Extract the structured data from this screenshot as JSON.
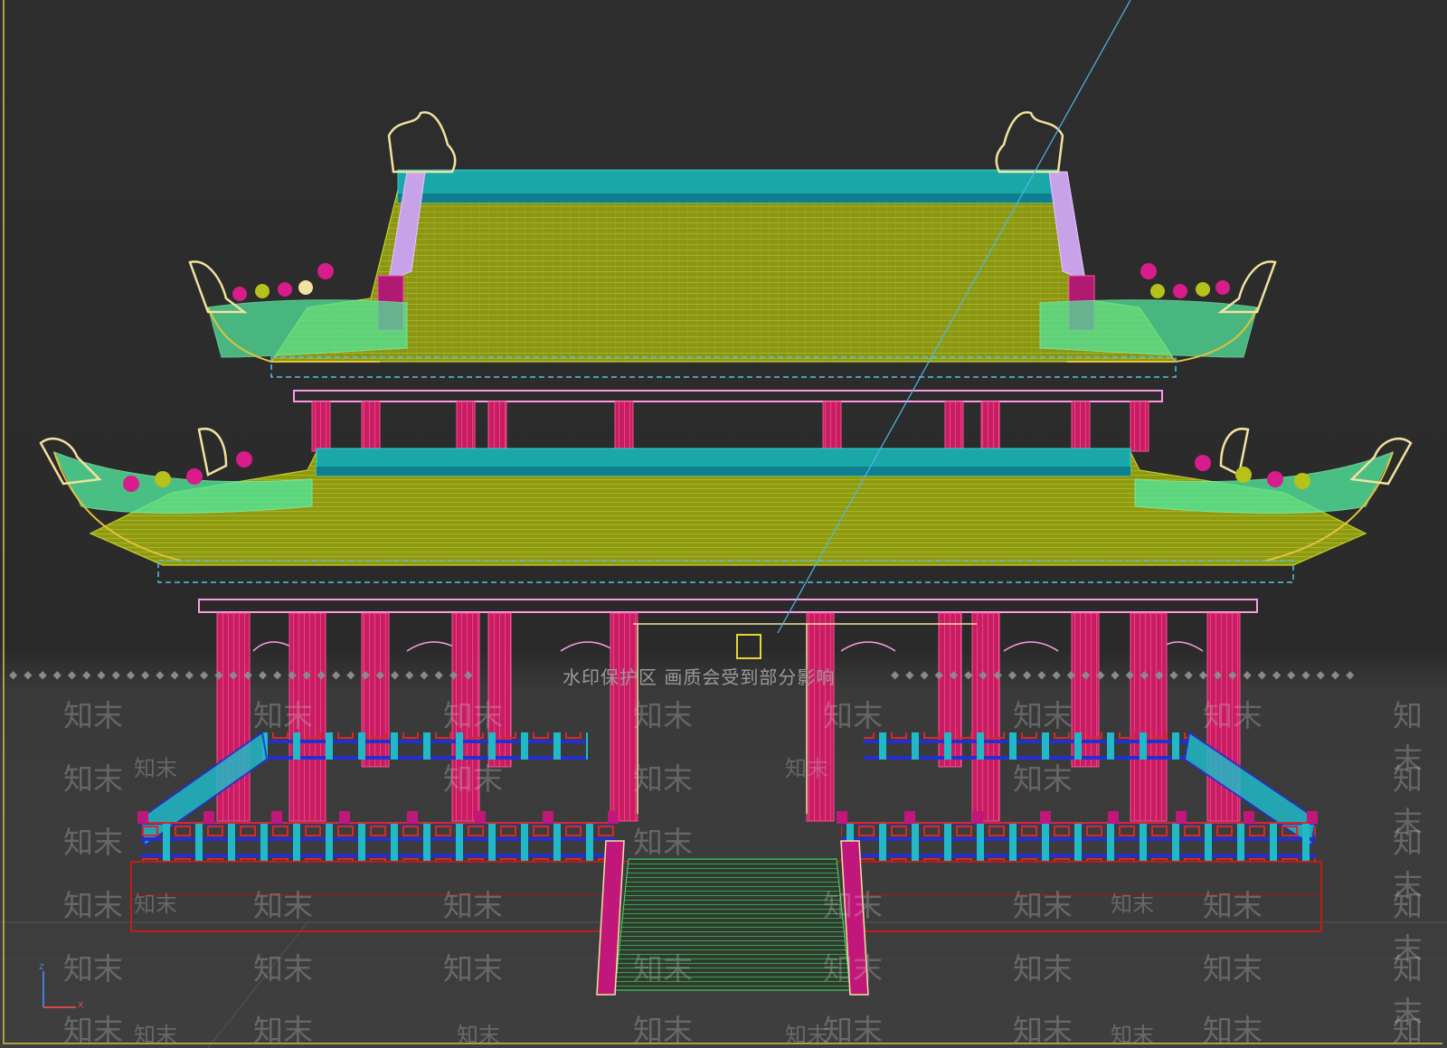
{
  "viewport": {
    "background_top": "#2e2e2e",
    "background_bottom": "#3c3c3c",
    "frame_color": "#b89b46"
  },
  "watermark": {
    "banner_text": "水印保护区  画质会受到部分影响",
    "tile_text": "知末",
    "color": "#bdbdbd"
  },
  "axis_gizmo": {
    "z_label": "z",
    "x_label": "x",
    "z_color": "#4a7bd6",
    "x_color": "#d64a4a"
  },
  "palette": {
    "roof_fill": "#8e9a12",
    "roof_line": "#b8c224",
    "ridge": "#1aa7a7",
    "ridge_dark": "#0f7f8f",
    "eave_green": "#52e59a",
    "column": "#e0246e",
    "column_line": "#ff4f96",
    "railing_blue": "#2330d0",
    "railing_cyan": "#21b9c7",
    "railing_red": "#d62929",
    "beam_pink": "#ff9be6",
    "ornament_cream": "#f2e2a0",
    "ornament_magenta": "#d81c8c",
    "base_red": "#c21b1b",
    "stair_green": "#39e05a",
    "guide_line": "#4fb8e8"
  }
}
